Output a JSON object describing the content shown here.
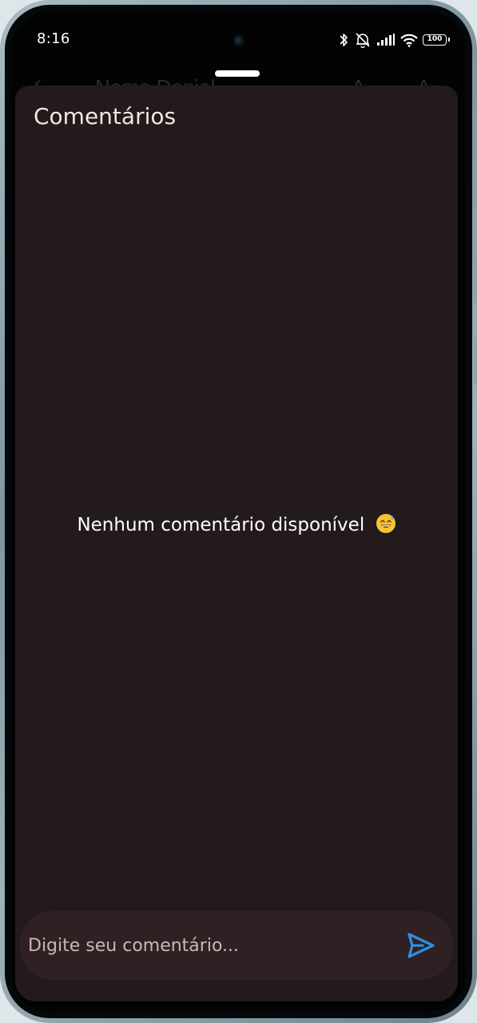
{
  "status_bar": {
    "time": "8:16",
    "battery_level": "100",
    "icons": [
      "bluetooth-icon",
      "alarm-off-icon",
      "signal-icon",
      "wifi-icon",
      "battery-icon"
    ]
  },
  "background_screen": {
    "title": "Nome Daniel",
    "actions": "A A"
  },
  "sheet": {
    "title": "Comentários",
    "empty_message": "Nenhum comentário disponível",
    "empty_emoji": "grinning-sweat-emoji"
  },
  "composer": {
    "placeholder": "Digite seu comentário...",
    "value": "",
    "send_icon": "send-icon"
  },
  "colors": {
    "sheet_background": "#231a1b",
    "composer_background": "#2f2123",
    "accent": "#2f8fe0",
    "text_primary": "#ffffff"
  }
}
